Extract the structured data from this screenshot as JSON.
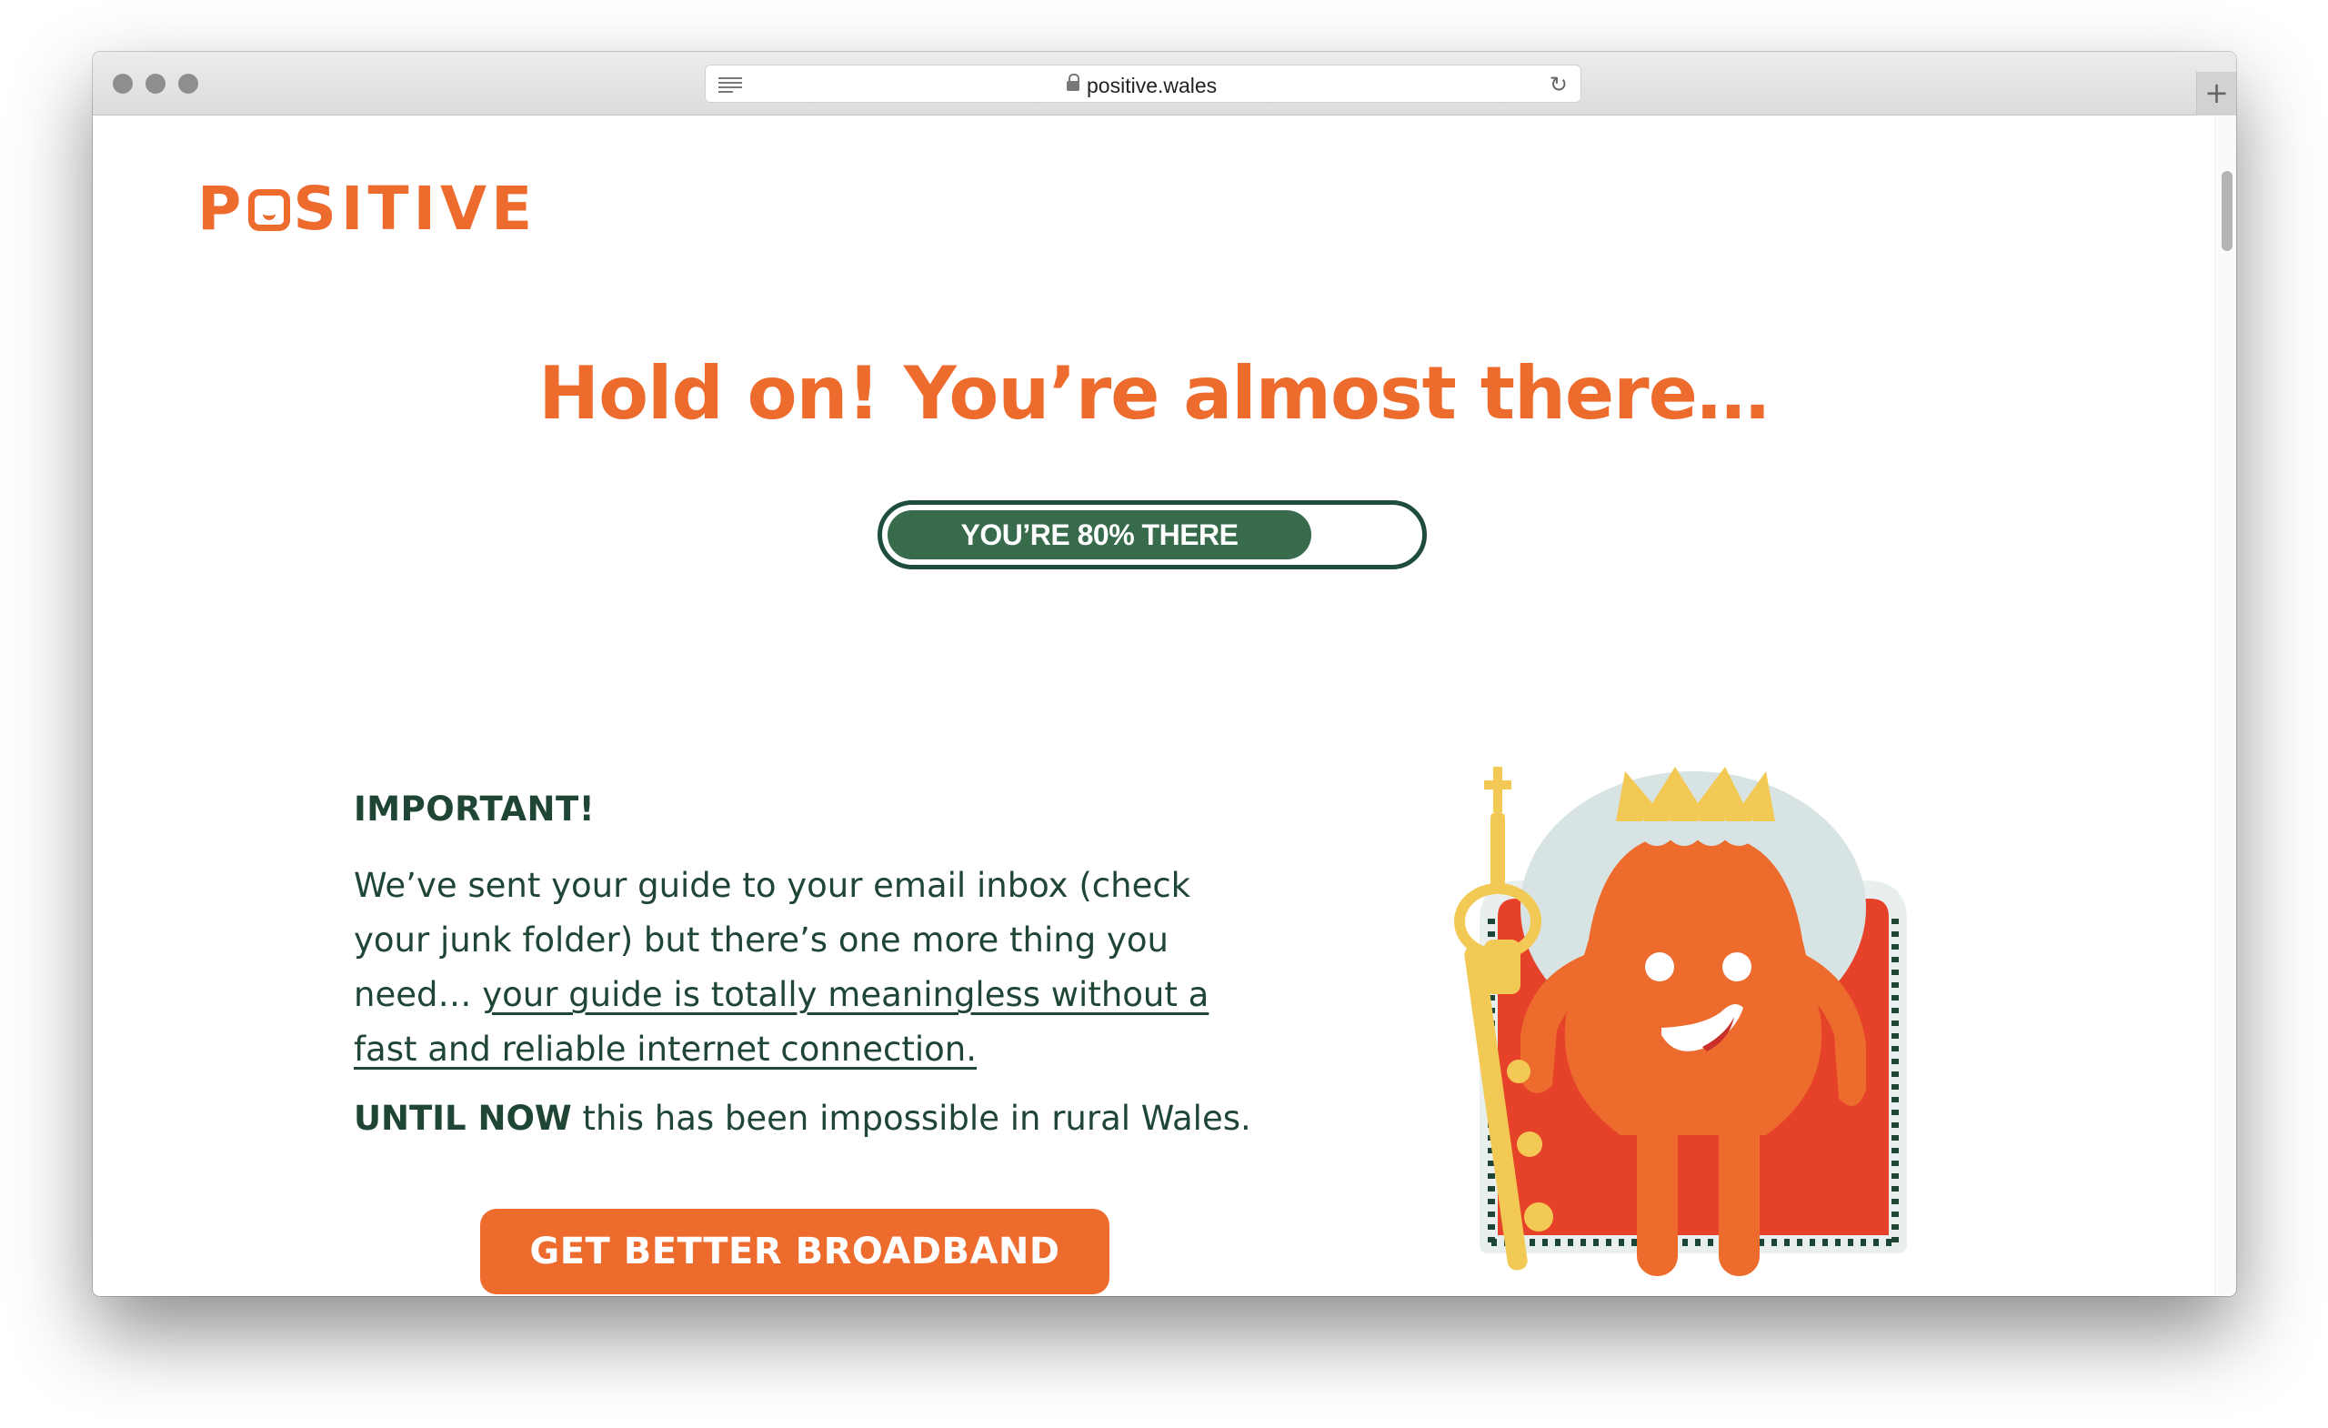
{
  "browser": {
    "url": "positive.wales",
    "reader_icon": "reader-icon",
    "lock_icon": "lock-icon",
    "reload_icon": "reload-icon",
    "new_tab_icon": "plus-icon"
  },
  "brand": {
    "logo": "POSITIVE",
    "accent_color": "#ed6b2d",
    "dark_green": "#1f4535"
  },
  "hero": {
    "headline": "Hold on! You’re almost there…"
  },
  "progress": {
    "label": "YOU’RE 80% THERE",
    "value": 0.8,
    "fill_color": "#376b4c"
  },
  "content": {
    "important": "IMPORTANT!",
    "paragraph_start": "We’ve sent your guide to your email inbox (check your junk folder) but there’s one more thing you need… ",
    "paragraph_link": "your guide is totally meaningless without a fast and reliable internet connection.",
    "until_bold": "UNTIL NOW",
    "until_rest": " this has been impossible in rural Wales."
  },
  "cta": {
    "label": "GET BETTER BROADBAND NOW"
  },
  "illustration": {
    "icon": "king-mascot-illustration"
  }
}
